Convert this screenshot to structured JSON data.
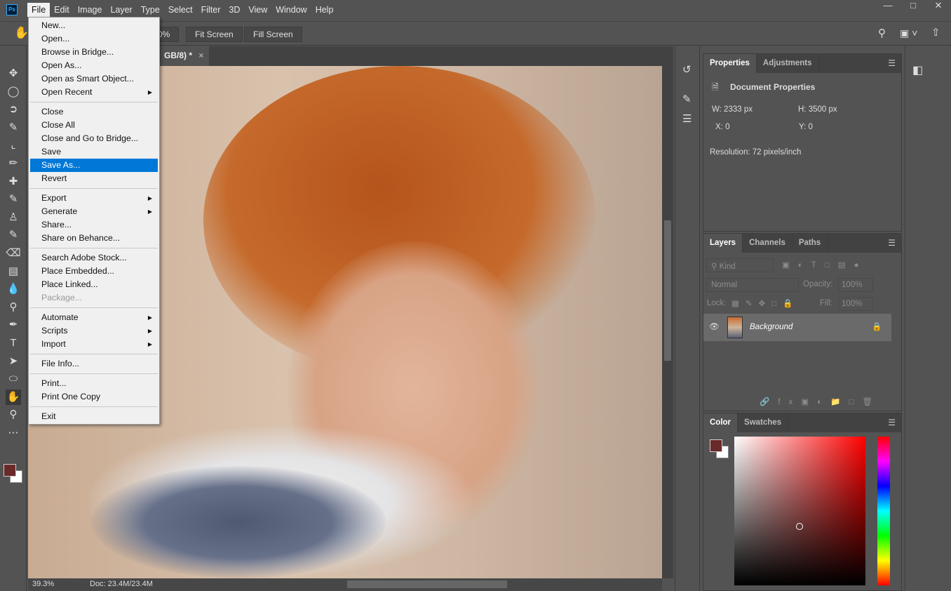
{
  "app_logo": "Ps",
  "menubar": [
    "File",
    "Edit",
    "Image",
    "Layer",
    "Type",
    "Select",
    "Filter",
    "3D",
    "View",
    "Window",
    "Help"
  ],
  "options": {
    "zoom_partial": "0%",
    "fit_screen": "Fit Screen",
    "fill_screen": "Fill Screen"
  },
  "document_tab": {
    "title": "GB/8) *",
    "close": "×"
  },
  "file_menu": [
    {
      "label": "New..."
    },
    {
      "label": "Open..."
    },
    {
      "label": "Browse in Bridge..."
    },
    {
      "label": "Open As..."
    },
    {
      "label": "Open as Smart Object..."
    },
    {
      "label": "Open Recent",
      "submenu": true
    },
    {
      "sep": true
    },
    {
      "label": "Close"
    },
    {
      "label": "Close All"
    },
    {
      "label": "Close and Go to Bridge..."
    },
    {
      "label": "Save"
    },
    {
      "label": "Save As...",
      "selected": true
    },
    {
      "label": "Revert"
    },
    {
      "sep": true
    },
    {
      "label": "Export",
      "submenu": true
    },
    {
      "label": "Generate",
      "submenu": true
    },
    {
      "label": "Share..."
    },
    {
      "label": "Share on Behance..."
    },
    {
      "sep": true
    },
    {
      "label": "Search Adobe Stock..."
    },
    {
      "label": "Place Embedded..."
    },
    {
      "label": "Place Linked..."
    },
    {
      "label": "Package...",
      "disabled": true
    },
    {
      "sep": true
    },
    {
      "label": "Automate",
      "submenu": true
    },
    {
      "label": "Scripts",
      "submenu": true
    },
    {
      "label": "Import",
      "submenu": true
    },
    {
      "sep": true
    },
    {
      "label": "File Info..."
    },
    {
      "sep": true
    },
    {
      "label": "Print..."
    },
    {
      "label": "Print One Copy"
    },
    {
      "sep": true
    },
    {
      "label": "Exit"
    }
  ],
  "status": {
    "zoom": "39.3%",
    "doc": "Doc: 23.4M/23.4M"
  },
  "properties": {
    "tabs": [
      "Properties",
      "Adjustments"
    ],
    "section": "Document Properties",
    "w_label": "W:",
    "w": "2333 px",
    "h_label": "H:",
    "h": "3500 px",
    "x_label": "X:",
    "x": "0",
    "y_label": "Y:",
    "y": "0",
    "resolution": "Resolution: 72 pixels/inch"
  },
  "layers": {
    "tabs": [
      "Layers",
      "Channels",
      "Paths"
    ],
    "kind": "Kind",
    "blend": "Normal",
    "opacity_label": "Opacity:",
    "opacity": "100%",
    "lock_label": "Lock:",
    "fill_label": "Fill:",
    "fill": "100%",
    "layer_name": "Background"
  },
  "color": {
    "tabs": [
      "Color",
      "Swatches"
    ],
    "foreground": "#6b2a2a",
    "background": "#ffffff",
    "hue_base": "#ff0000"
  }
}
